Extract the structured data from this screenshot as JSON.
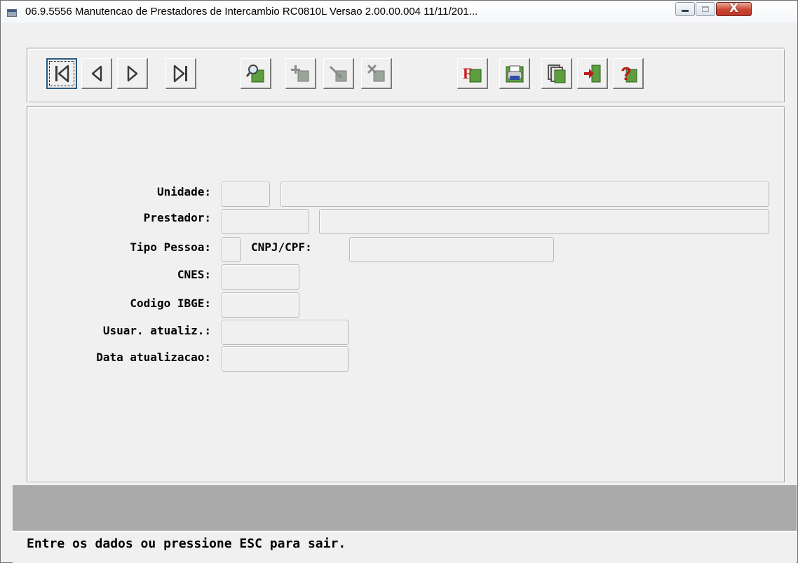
{
  "window": {
    "title": "06.9.5556  Manutencao de Prestadores de Intercambio RC0810L Versao 2.00.00.004 11/11/201...",
    "minimize_icon": "minimize-icon",
    "maximize_icon": "maximize-icon",
    "close_glyph": "X"
  },
  "toolbar": {
    "buttons": [
      {
        "name": "first-record-button",
        "icon": "first-record-icon"
      },
      {
        "name": "previous-record-button",
        "icon": "previous-record-icon"
      },
      {
        "name": "next-record-button",
        "icon": "next-record-icon"
      },
      {
        "name": "last-record-button",
        "icon": "last-record-icon"
      },
      {
        "name": "search-button",
        "icon": "search-icon"
      },
      {
        "name": "add-button",
        "icon": "add-icon"
      },
      {
        "name": "edit-button",
        "icon": "edit-icon"
      },
      {
        "name": "delete-button",
        "icon": "delete-icon"
      },
      {
        "name": "filter-button",
        "icon": "filter-icon"
      },
      {
        "name": "print-button",
        "icon": "print-icon"
      },
      {
        "name": "copy-button",
        "icon": "copy-icon"
      },
      {
        "name": "exit-button",
        "icon": "exit-icon"
      },
      {
        "name": "help-button",
        "icon": "help-icon"
      }
    ],
    "filter_glyph": "F",
    "help_glyph": "?"
  },
  "form": {
    "unidade_label": "Unidade:",
    "prestador_label": "Prestador:",
    "tipo_pessoa_label": "Tipo Pessoa:",
    "cnpj_cpf_label": "CNPJ/CPF:",
    "cnes_label": "CNES:",
    "codigo_ibge_label": "Codigo IBGE:",
    "usuar_atualiz_label": "Usuar. atualiz.:",
    "data_atualizacao_label": "Data atualizacao:",
    "unidade_code": "",
    "unidade_name": "",
    "prestador_code": "",
    "prestador_name": "",
    "tipo_pessoa": "",
    "cnpj_cpf": "",
    "cnes": "",
    "codigo_ibge": "",
    "usuar_atualiz": "",
    "data_atualizacao": ""
  },
  "status": {
    "message": "Entre os dados ou pressione ESC para sair."
  }
}
